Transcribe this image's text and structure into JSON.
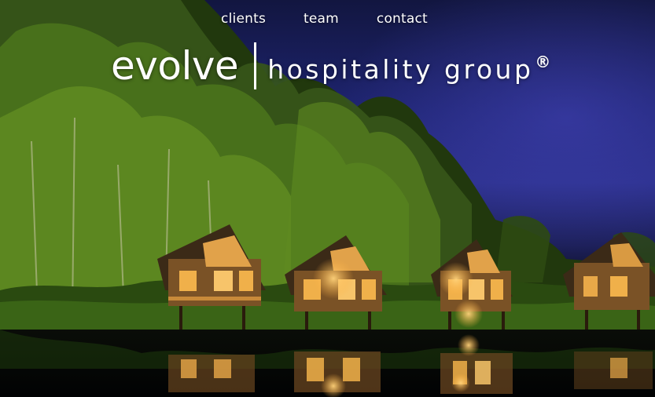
{
  "nav": {
    "items": [
      "clients",
      "team",
      "contact"
    ]
  },
  "logo": {
    "main": "evolve",
    "sub": "hospitality group",
    "registered": "®"
  },
  "colors": {
    "text": "#ffffff",
    "sky": "#2a2f88",
    "foliage": "#4f7a1c",
    "cabin_light": "#f0b04a"
  },
  "hero_image": {
    "icons": [
      "forest-trees",
      "stilt-cabin",
      "stilt-cabin",
      "stilt-cabin",
      "stilt-cabin",
      "lake-reflection"
    ]
  }
}
